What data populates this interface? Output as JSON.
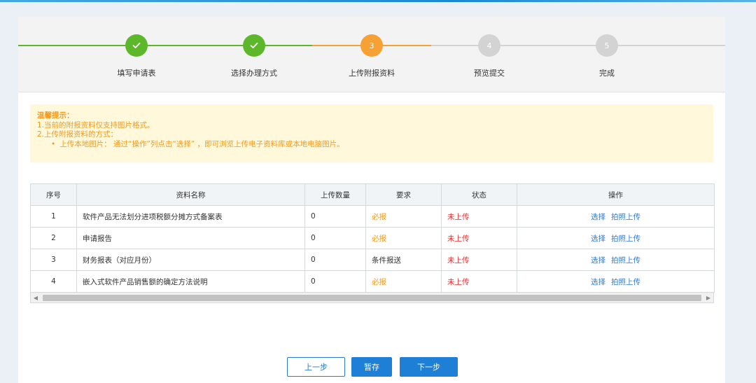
{
  "steps": [
    {
      "number": "1",
      "label": "填写申请表",
      "state": "done"
    },
    {
      "number": "2",
      "label": "选择办理方式",
      "state": "done"
    },
    {
      "number": "3",
      "label": "上传附报资料",
      "state": "active"
    },
    {
      "number": "4",
      "label": "预览提交",
      "state": "todo"
    },
    {
      "number": "5",
      "label": "完成",
      "state": "todo"
    }
  ],
  "tip": {
    "title": "温馨提示：",
    "line1": "1.当前的附报资料仅支持图片格式。",
    "line2": "2.上传附报资料的方式：",
    "bullet": "上传本地图片：  通过“操作”列点击“选择” ，即可浏览上传电子资料库或本地电脑图片。"
  },
  "table": {
    "headers": [
      "序号",
      "资料名称",
      "上传数量",
      "要求",
      "状态",
      "操作"
    ],
    "rows": [
      {
        "index": "1",
        "name": "软件产品无法划分进项税额分摊方式备案表",
        "count": "0",
        "requirement": "必报",
        "status": "未上传",
        "op1": "选择",
        "op2": "拍照上传"
      },
      {
        "index": "2",
        "name": "申请报告",
        "count": "0",
        "requirement": "必报",
        "status": "未上传",
        "op1": "选择",
        "op2": "拍照上传"
      },
      {
        "index": "3",
        "name": "财务报表（对应月份）",
        "count": "0",
        "requirement": "条件报送",
        "status": "未上传",
        "op1": "选择",
        "op2": "拍照上传"
      },
      {
        "index": "4",
        "name": "嵌入式软件产品销售额的确定方法说明",
        "count": "0",
        "requirement": "必报",
        "status": "未上传",
        "op1": "选择",
        "op2": "拍照上传"
      }
    ]
  },
  "buttons": {
    "prev": "上一步",
    "save": "暂存",
    "next": "下一步"
  },
  "colors": {
    "done": "#5cb82a",
    "active": "#f7a135",
    "todo": "#d3d3d3",
    "primary": "#1e7fd6",
    "warning_text": "#f39a1d",
    "error_text": "#e52b2b"
  }
}
